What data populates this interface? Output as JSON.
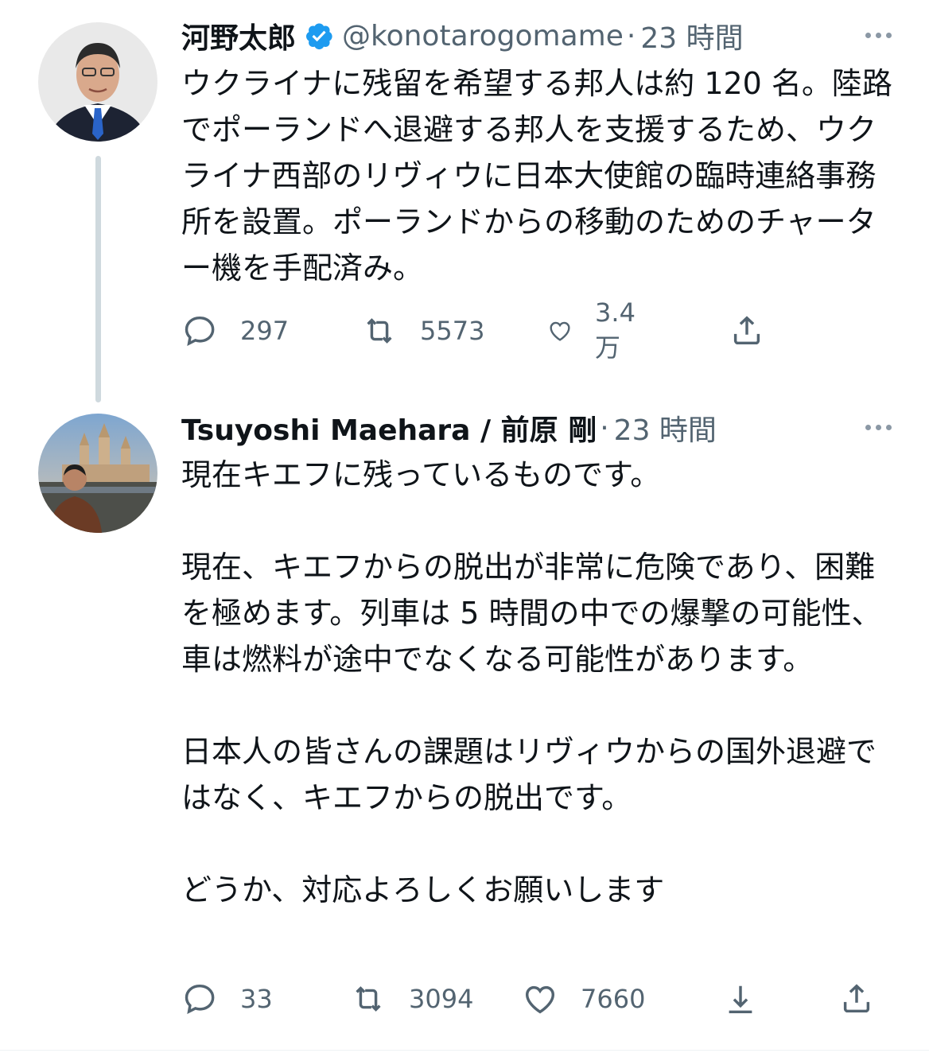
{
  "tweets": [
    {
      "author": {
        "name": "河野太郎",
        "handle": "@konotarogomame",
        "verified": true
      },
      "separator": "·",
      "time": "23 時間",
      "text": [
        "ウクライナに残留を希望する邦人は約 120 名。陸路でポーランドへ退避する邦人を支援するため、ウクライナ西部のリヴィウに日本大使館の臨時連絡事務所を設置。ポーランドからの移動のためのチャーター機を手配済み。"
      ],
      "stats": {
        "replies": "297",
        "retweets": "5573",
        "likes": "3.4 万"
      },
      "actions": [
        "reply-icon",
        "retweet-icon",
        "like-icon",
        "share-icon"
      ]
    },
    {
      "author": {
        "name": "Tsuyoshi Maehara / 前原 剛",
        "verified": false
      },
      "separator": "·",
      "time": "23 時間",
      "text": [
        "現在キエフに残っているものです。",
        "現在、キエフからの脱出が非常に危険であり、困難を極めます。列車は 5 時間の中での爆撃の可能性、車は燃料が途中でなくなる可能性があります。",
        "日本人の皆さんの課題はリヴィウからの国外退避ではなく、キエフからの脱出です。",
        "どうか、対応よろしくお願いします"
      ],
      "stats": {
        "replies": "33",
        "retweets": "3094",
        "likes": "7660"
      },
      "actions": [
        "reply-icon",
        "retweet-icon",
        "like-icon",
        "download-icon",
        "share-icon"
      ]
    }
  ],
  "colors": {
    "text": "#0f1419",
    "secondary": "#536471",
    "verified": "#1d9bf0",
    "thread_line": "#cfd9de"
  }
}
